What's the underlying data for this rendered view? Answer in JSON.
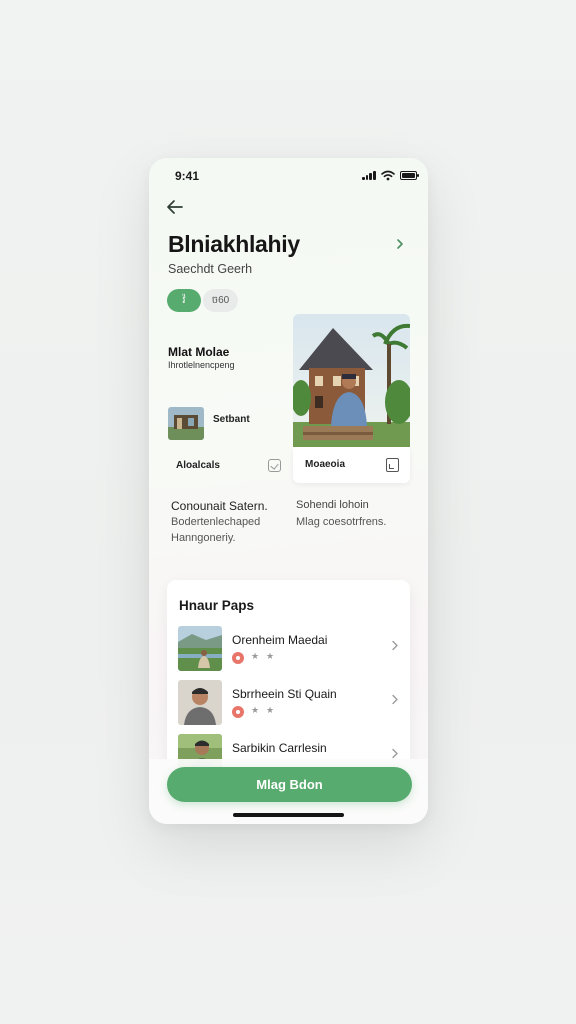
{
  "status_bar": {
    "time": "9:41"
  },
  "header": {
    "title": "Blniakhlahiy",
    "subtitle": "Saechdt Geerh",
    "chips": [
      "វ៉",
      "ច60"
    ]
  },
  "featured": {
    "title": "Mlat Molae",
    "subtitle": "Ihrotlelnencpeng",
    "thumb_label": "Setbant",
    "card_left_label": "Aloalcals",
    "card_right_label": "Moaeoia"
  },
  "descriptions": {
    "left_line1": "Conounait Satern.",
    "left_line2": "Bodertenlechaped",
    "left_line3": "Hanngoneriy.",
    "right_line1": "Sohendi lohoin",
    "right_line2": "Mlag coesotrfrens."
  },
  "list": {
    "title": "Hnaur Paps",
    "items": [
      {
        "name": "Orenheim Maedai",
        "stars": [
          "★",
          "★"
        ]
      },
      {
        "name": "Sbrrheein Sti Quain",
        "stars": [
          "★",
          "★"
        ]
      },
      {
        "name": "Sarbikin Carrlesin",
        "stars": []
      }
    ]
  },
  "cta": {
    "label": "Mlag Bdon"
  },
  "colors": {
    "accent": "#58ab6f",
    "badge": "#e8756a"
  }
}
